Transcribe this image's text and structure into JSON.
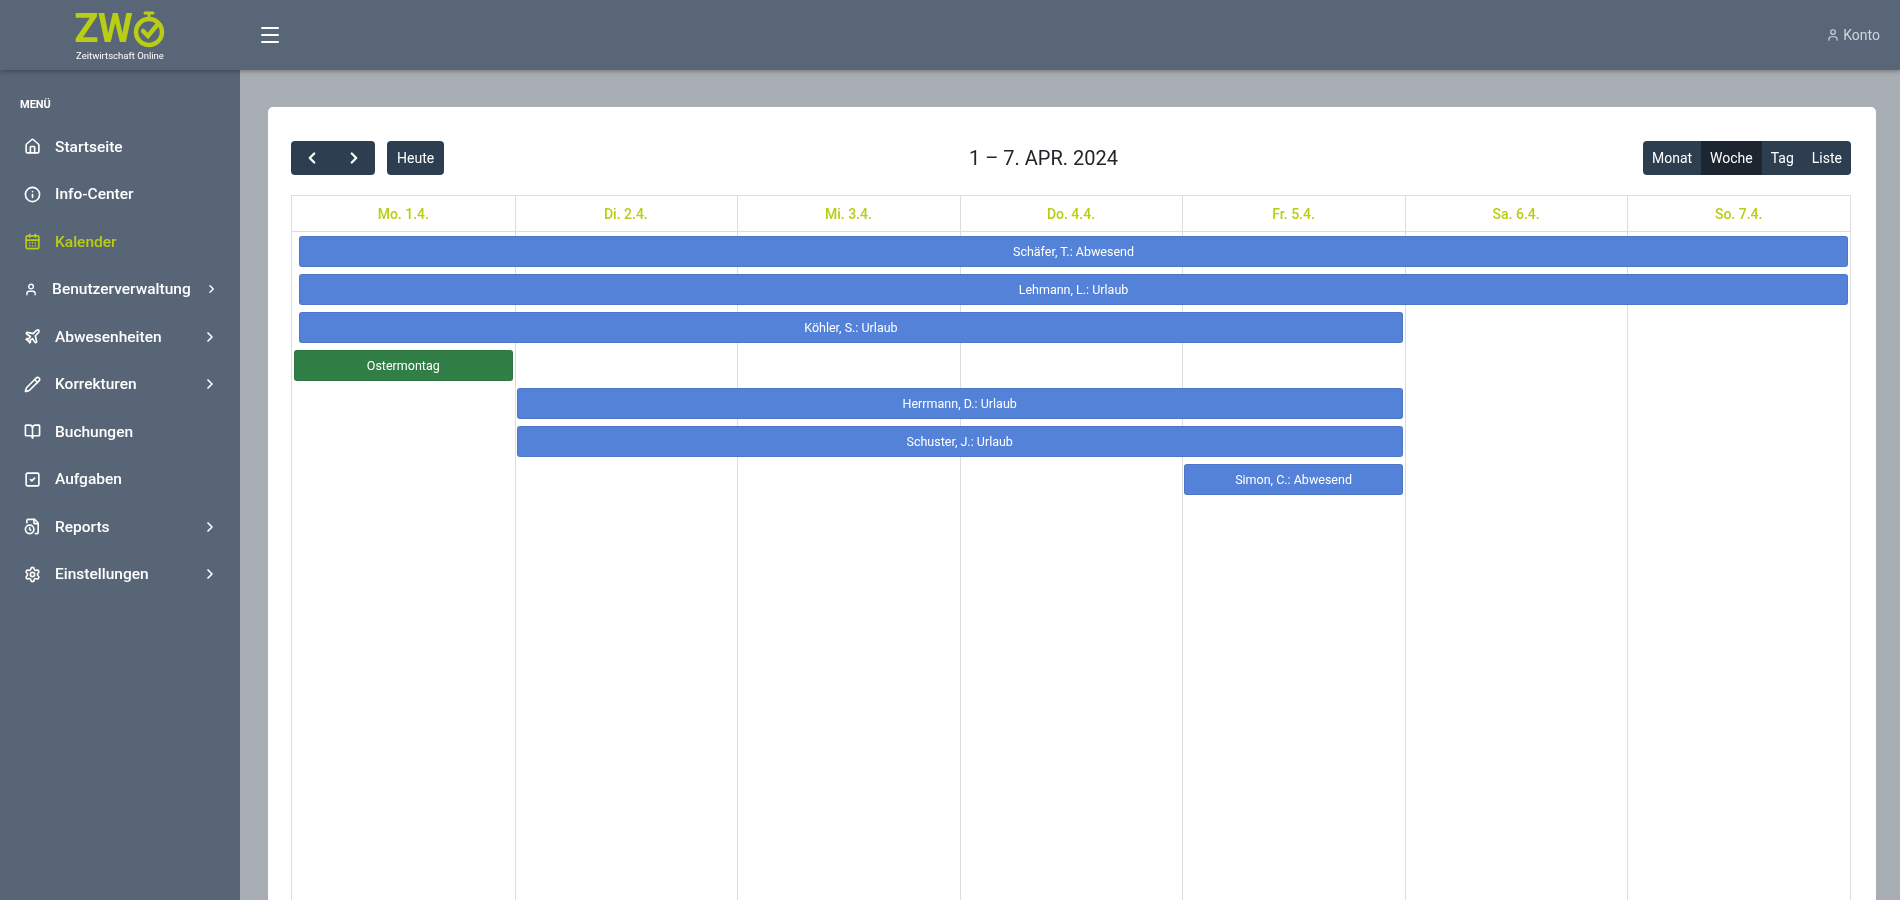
{
  "logo": {
    "letters": "ZW",
    "tagline": "Zeitwirtschaft Online"
  },
  "header": {
    "account": "Konto"
  },
  "sidebar": {
    "heading": "MENÜ",
    "items": [
      {
        "label": "Startseite",
        "selected": false,
        "submenu": false
      },
      {
        "label": "Info-Center",
        "selected": false,
        "submenu": false
      },
      {
        "label": "Kalender",
        "selected": true,
        "submenu": false
      },
      {
        "label": "Benutzerverwaltung",
        "selected": false,
        "submenu": true
      },
      {
        "label": "Abwesenheiten",
        "selected": false,
        "submenu": true
      },
      {
        "label": "Korrekturen",
        "selected": false,
        "submenu": true
      },
      {
        "label": "Buchungen",
        "selected": false,
        "submenu": false
      },
      {
        "label": "Aufgaben",
        "selected": false,
        "submenu": false
      },
      {
        "label": "Reports",
        "selected": false,
        "submenu": true
      },
      {
        "label": "Einstellungen",
        "selected": false,
        "submenu": true
      }
    ]
  },
  "calendar": {
    "today_button": "Heute",
    "title": "1 – 7. APR. 2024",
    "views": [
      {
        "label": "Monat",
        "selected": false
      },
      {
        "label": "Woche",
        "selected": true
      },
      {
        "label": "Tag",
        "selected": false
      },
      {
        "label": "Liste",
        "selected": false
      }
    ],
    "days": [
      "Mo. 1.4.",
      "Di. 2.4.",
      "Mi. 3.4.",
      "Do. 4.4.",
      "Fr. 5.4.",
      "Sa. 6.4.",
      "So. 7.4."
    ],
    "events": [
      {
        "label": "Schäfer, T.: Abwesend",
        "color": "#5382d8",
        "covers": [
          true,
          true,
          true,
          true,
          true,
          true,
          true
        ]
      },
      {
        "label": "Lehmann, L.: Urlaub",
        "color": "#5382d8",
        "covers": [
          true,
          true,
          true,
          true,
          true,
          true,
          true
        ]
      },
      {
        "label": "Köhler, S.: Urlaub",
        "color": "#5382d8",
        "covers": [
          true,
          true,
          true,
          true,
          true,
          false,
          false
        ]
      },
      {
        "label": "Ostermontag",
        "color": "#327e47",
        "covers": [
          true,
          false,
          false,
          false,
          false,
          false,
          false
        ]
      },
      {
        "label": "Herrmann, D.: Urlaub",
        "color": "#5382d8",
        "covers": [
          false,
          true,
          true,
          true,
          true,
          false,
          false
        ]
      },
      {
        "label": "Schuster, J.: Urlaub",
        "color": "#5382d8",
        "covers": [
          false,
          true,
          true,
          true,
          true,
          false,
          false
        ]
      },
      {
        "label": "Simon, C.: Abwesend",
        "color": "#5382d8",
        "covers": [
          false,
          false,
          false,
          false,
          true,
          false,
          false
        ]
      }
    ]
  }
}
